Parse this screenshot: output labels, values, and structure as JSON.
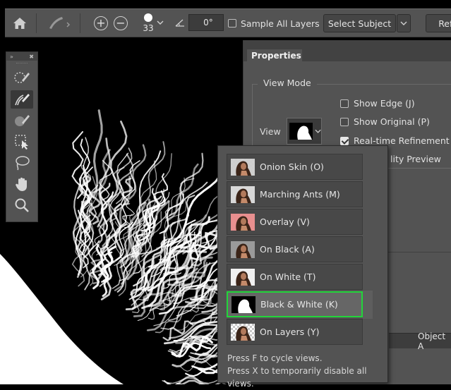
{
  "options_bar": {
    "icons": [
      "home-icon",
      "refine-edge-brush-icon",
      "add-to-selection-icon",
      "subtract-from-selection-icon"
    ],
    "brush_size": "33",
    "angle_value": "0°",
    "sample_all_layers_label": "Sample All Layers",
    "sample_all_layers_checked": false,
    "select_subject_label": "Select Subject",
    "refine_label": "Refin"
  },
  "tools": {
    "items": [
      "quick-selection-icon",
      "refine-edge-brush-icon",
      "brush-icon",
      "object-selection-icon",
      "lasso-icon",
      "hand-icon",
      "zoom-icon"
    ],
    "active_index": 1
  },
  "properties": {
    "tab_label": "Properties",
    "view_mode_title": "View Mode",
    "view_label": "View",
    "options": [
      {
        "label": "Show Edge (J)",
        "checked": false
      },
      {
        "label": "Show Original (P)",
        "checked": false
      },
      {
        "label": "Real-time Refinement",
        "checked": true
      },
      {
        "label": "lity Preview",
        "checked": null
      }
    ],
    "object_label": "Object A"
  },
  "view_menu": {
    "items": [
      {
        "label": "Onion Skin (O)",
        "thumb": "onion"
      },
      {
        "label": "Marching Ants (M)",
        "thumb": "ants"
      },
      {
        "label": "Overlay (V)",
        "thumb": "overlay"
      },
      {
        "label": "On Black (A)",
        "thumb": "black"
      },
      {
        "label": "On White (T)",
        "thumb": "white"
      },
      {
        "label": "Black & White (K)",
        "thumb": "bw"
      },
      {
        "label": "On Layers (Y)",
        "thumb": "layers"
      }
    ],
    "selected_index": 5,
    "footer_line1": "Press F to cycle views.",
    "footer_line2": "Press X to temporarily disable all views."
  },
  "colors": {
    "panel": "#535353",
    "highlight": "#22d53a"
  }
}
